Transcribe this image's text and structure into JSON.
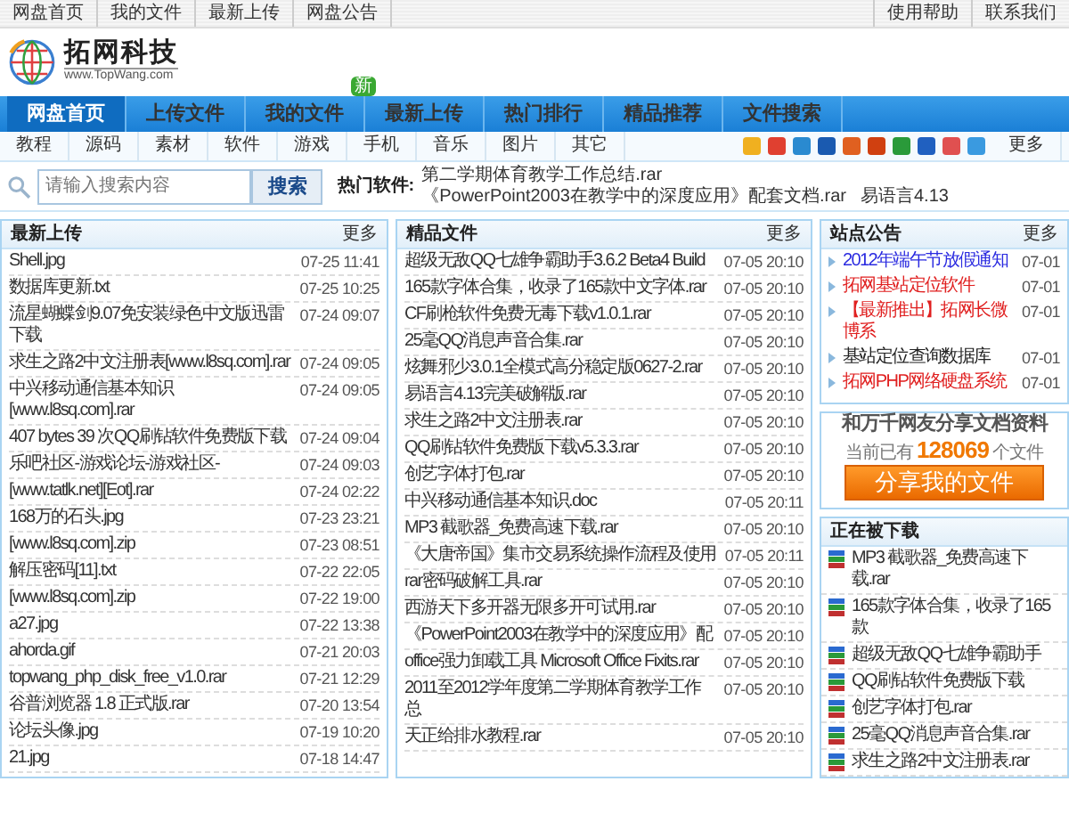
{
  "top_links": {
    "left": [
      "网盘首页",
      "我的文件",
      "最新上传",
      "网盘公告"
    ],
    "right": [
      "使用帮助",
      "联系我们"
    ]
  },
  "logo": {
    "name": "拓网科技",
    "url": "www.TopWang.com"
  },
  "nav": [
    {
      "label": "网盘首页",
      "selected": true
    },
    {
      "label": "上传文件",
      "selected": false
    },
    {
      "label": "我的文件",
      "selected": false,
      "badge": "新"
    },
    {
      "label": "最新上传",
      "selected": false
    },
    {
      "label": "热门排行",
      "selected": false
    },
    {
      "label": "精品推荐",
      "selected": false
    },
    {
      "label": "文件搜索",
      "selected": false
    }
  ],
  "categories": [
    "教程",
    "源码",
    "素材",
    "软件",
    "游戏",
    "手机",
    "音乐",
    "图片",
    "其它"
  ],
  "category_more": "更多",
  "search": {
    "placeholder": "请输入搜索内容",
    "button": "搜索"
  },
  "hot": {
    "label": "热门软件:",
    "items": [
      "第二学期体育教学工作总结.rar",
      "《PowerPoint2003在教学中的深度应用》配套文档.rar",
      "易语言4.13"
    ]
  },
  "latest": {
    "title": "最新上传",
    "more": "更多",
    "rows": [
      {
        "name": "Shell.jpg",
        "time": "07-25 11:41"
      },
      {
        "name": "数据库更新.txt",
        "time": "07-25 10:25"
      },
      {
        "name": "流星蝴蝶剑9.07免安装绿色中文版迅雷下载",
        "time": "07-24 09:07"
      },
      {
        "name": "求生之路2中文注册表[www.l8sq.com].rar",
        "time": "07-24 09:05"
      },
      {
        "name": "中兴移动通信基本知识[www.l8sq.com].rar",
        "time": "07-24 09:05"
      },
      {
        "name": "407 bytes 39 次QQ刷钻软件免费版下载",
        "time": "07-24 09:04"
      },
      {
        "name": "乐吧社区-游戏论坛-游戏社区-",
        "time": "07-24 09:03"
      },
      {
        "name": "[www.tatlk.net][Eot].rar",
        "time": "07-24 02:22"
      },
      {
        "name": "168万的石头.jpg",
        "time": "07-23 23:21"
      },
      {
        "name": "[www.l8sq.com].zip",
        "time": "07-23 08:51"
      },
      {
        "name": "解压密码[11].txt",
        "time": "07-22 22:05"
      },
      {
        "name": "[www.l8sq.com].zip",
        "time": "07-22 19:00"
      },
      {
        "name": "a27.jpg",
        "time": "07-22 13:38"
      },
      {
        "name": "ahorda.gif",
        "time": "07-21 20:03"
      },
      {
        "name": "topwang_php_disk_free_v1.0.rar",
        "time": "07-21 12:29"
      },
      {
        "name": "谷普浏览器 1.8 正式版.rar",
        "time": "07-20 13:54"
      },
      {
        "name": "论坛头像.jpg",
        "time": "07-19 10:20"
      },
      {
        "name": "21.jpg",
        "time": "07-18 14:47"
      }
    ]
  },
  "featured": {
    "title": "精品文件",
    "more": "更多",
    "rows": [
      {
        "name": "超级无敌QQ七雄争霸助手3.6.2 Beta4 Build",
        "time": "07-05 20:10"
      },
      {
        "name": "165款字体合集，收录了165款中文字体.rar",
        "time": "07-05 20:10"
      },
      {
        "name": "CF刷枪软件免费无毒下载v1.0.1.rar",
        "time": "07-05 20:10"
      },
      {
        "name": "25毫QQ消息声音合集.rar",
        "time": "07-05 20:10"
      },
      {
        "name": "炫舞邪少3.0.1全模式高分稳定版0627-2.rar",
        "time": "07-05 20:10"
      },
      {
        "name": "易语言4.13完美破解版.rar",
        "time": "07-05 20:10"
      },
      {
        "name": "求生之路2中文注册表.rar",
        "time": "07-05 20:10"
      },
      {
        "name": "QQ刷钻软件免费版下载v5.3.3.rar",
        "time": "07-05 20:10"
      },
      {
        "name": "创艺字体打包.rar",
        "time": "07-05 20:10"
      },
      {
        "name": "中兴移动通信基本知识.doc",
        "time": "07-05 20:11"
      },
      {
        "name": "MP3 截歌器_免费高速下载.rar",
        "time": "07-05 20:10"
      },
      {
        "name": "《大唐帝国》集市交易系统操作流程及使用",
        "time": "07-05 20:11"
      },
      {
        "name": "rar密码破解工具.rar",
        "time": "07-05 20:10"
      },
      {
        "name": "西游天下多开器无限多开可试用.rar",
        "time": "07-05 20:10"
      },
      {
        "name": "《PowerPoint2003在教学中的深度应用》配",
        "time": "07-05 20:10"
      },
      {
        "name": "office强力卸载工具 Microsoft Office Fixits.rar",
        "time": "07-05 20:10"
      },
      {
        "name": "2011至2012学年度第二学期体育教学工作总",
        "time": "07-05 20:10"
      },
      {
        "name": "天正给排水教程.rar",
        "time": "07-05 20:10"
      }
    ]
  },
  "notices": {
    "title": "站点公告",
    "more": "更多",
    "rows": [
      {
        "text": "2012年端午节放假通知",
        "time": "07-01",
        "color": "#2a2ae0"
      },
      {
        "text": "拓网基站定位软件",
        "time": "07-01",
        "color": "#e02020"
      },
      {
        "text": "【最新推出】拓网长微博系",
        "time": "07-01",
        "color": "#e02020"
      },
      {
        "text": "基站定位查询数据库",
        "time": "07-01",
        "color": "#222222"
      },
      {
        "text": "拓网PHP网络硬盘系统",
        "time": "07-01",
        "color": "#e02020"
      }
    ]
  },
  "share": {
    "title": "和万千网友分享文档资料",
    "count_line": "当前已有 **128069** 个文件",
    "button": "分享我的文件"
  },
  "downloading": {
    "title": "正在被下载",
    "rows": [
      "MP3 截歌器_免费高速下载.rar",
      "165款字体合集，收录了165款",
      "超级无敌QQ七雄争霸助手",
      "QQ刷钻软件免费版下载",
      "创艺字体打包.rar",
      "25毫QQ消息声音合集.rar",
      "求生之路2中文注册表.rar"
    ]
  }
}
